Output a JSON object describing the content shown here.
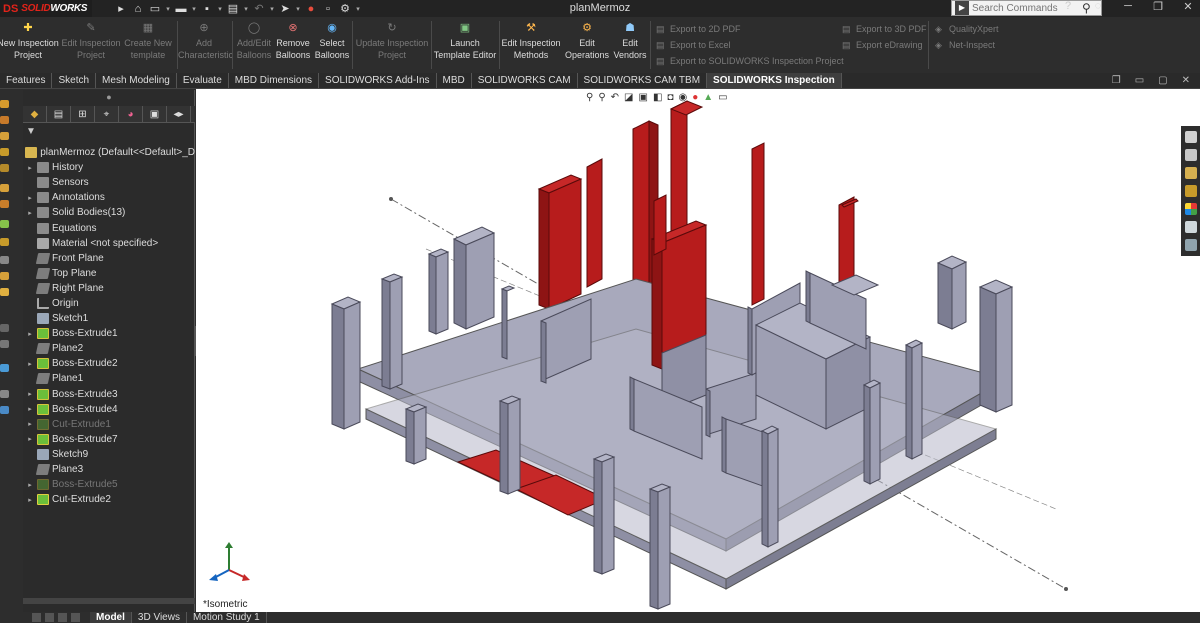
{
  "app": {
    "brand_prefix": "DS",
    "brand": "SOLID",
    "brand_suffix": "WORKS",
    "window_title": "planMermoz"
  },
  "search": {
    "placeholder": "Search Commands"
  },
  "ribbon": {
    "buttons": [
      {
        "line1": "New Inspection",
        "line2": "Project",
        "enabled": true
      },
      {
        "line1": "Edit Inspection",
        "line2": "Project",
        "enabled": false
      },
      {
        "line1": "Create New",
        "line2": "template",
        "enabled": false
      },
      {
        "line1": "Add",
        "line2": "Characteristic",
        "enabled": false
      },
      {
        "line1": "Add/Edit",
        "line2": "Balloons",
        "enabled": false
      },
      {
        "line1": "Remove",
        "line2": "Balloons",
        "enabled": true
      },
      {
        "line1": "Select",
        "line2": "Balloons",
        "enabled": true
      },
      {
        "line1": "Update Inspection",
        "line2": "Project",
        "enabled": false
      },
      {
        "line1": "Launch",
        "line2": "Template Editor",
        "enabled": true
      },
      {
        "line1": "Edit Inspection",
        "line2": "Methods",
        "enabled": true
      },
      {
        "line1": "Edit",
        "line2": "Operations",
        "enabled": true
      },
      {
        "line1": "Edit",
        "line2": "Vendors",
        "enabled": true
      }
    ],
    "export_col1": [
      "Export to 2D PDF",
      "Export to Excel",
      "Export to SOLIDWORKS Inspection Project"
    ],
    "export_col2": [
      "Export to 3D PDF",
      "Export eDrawing"
    ],
    "links": [
      "QualityXpert",
      "Net-Inspect"
    ]
  },
  "tabs": [
    "Features",
    "Sketch",
    "Mesh Modeling",
    "Evaluate",
    "MBD Dimensions",
    "SOLIDWORKS Add-Ins",
    "MBD",
    "SOLIDWORKS CAM",
    "SOLIDWORKS CAM TBM",
    "SOLIDWORKS Inspection"
  ],
  "active_tab": "SOLIDWORKS Inspection",
  "tree": [
    {
      "label": "planMermoz  (Default<<Default>_D",
      "icon": "part",
      "expand": "",
      "disabled": false
    },
    {
      "label": "History",
      "icon": "folder",
      "expand": "▸",
      "disabled": false
    },
    {
      "label": "Sensors",
      "icon": "folder",
      "expand": "",
      "disabled": false
    },
    {
      "label": "Annotations",
      "icon": "folder",
      "expand": "▸",
      "disabled": false
    },
    {
      "label": "Solid Bodies(13)",
      "icon": "folder",
      "expand": "▸",
      "disabled": false
    },
    {
      "label": "Equations",
      "icon": "eq",
      "expand": "",
      "disabled": false
    },
    {
      "label": "Material <not specified>",
      "icon": "mat",
      "expand": "",
      "disabled": false
    },
    {
      "label": "Front Plane",
      "icon": "plane",
      "expand": "",
      "disabled": false
    },
    {
      "label": "Top Plane",
      "icon": "plane",
      "expand": "",
      "disabled": false
    },
    {
      "label": "Right Plane",
      "icon": "plane",
      "expand": "",
      "disabled": false
    },
    {
      "label": "Origin",
      "icon": "orig",
      "expand": "",
      "disabled": false
    },
    {
      "label": "Sketch1",
      "icon": "sketch",
      "expand": "",
      "disabled": false
    },
    {
      "label": "Boss-Extrude1",
      "icon": "feat",
      "expand": "▸",
      "disabled": false
    },
    {
      "label": "Plane2",
      "icon": "plane",
      "expand": "",
      "disabled": false
    },
    {
      "label": "Boss-Extrude2",
      "icon": "feat",
      "expand": "▸",
      "disabled": false
    },
    {
      "label": "Plane1",
      "icon": "plane",
      "expand": "",
      "disabled": false
    },
    {
      "label": "Boss-Extrude3",
      "icon": "feat",
      "expand": "▸",
      "disabled": false
    },
    {
      "label": "Boss-Extrude4",
      "icon": "feat",
      "expand": "▸",
      "disabled": false
    },
    {
      "label": "Cut-Extrude1",
      "icon": "cut",
      "expand": "▸",
      "disabled": true
    },
    {
      "label": "Boss-Extrude7",
      "icon": "feat",
      "expand": "▸",
      "disabled": false
    },
    {
      "label": "Sketch9",
      "icon": "sketch",
      "expand": "",
      "disabled": false
    },
    {
      "label": "Plane3",
      "icon": "plane",
      "expand": "",
      "disabled": false
    },
    {
      "label": "Boss-Extrude5",
      "icon": "feat",
      "expand": "▸",
      "disabled": true
    },
    {
      "label": "Cut-Extrude2",
      "icon": "cut",
      "expand": "▸",
      "disabled": false
    }
  ],
  "viewport": {
    "view_label": "*Isometric"
  },
  "bottom_tabs": [
    "Model",
    "3D Views",
    "Motion Study 1"
  ],
  "active_bottom_tab": "Model",
  "colors": {
    "highlight_red": "#b71c1c",
    "body_gray": "#9e9fb3",
    "accent": "#e2231a"
  }
}
